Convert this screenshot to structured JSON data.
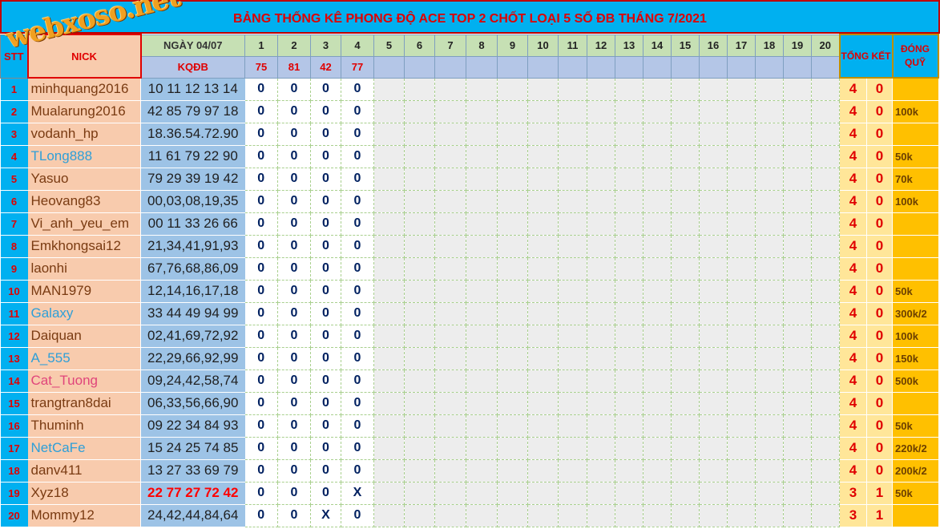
{
  "title": "BẢNG THỐNG KÊ PHONG ĐỘ ACE TOP 2 CHỐT LOẠI 5 SỐ ĐB THÁNG 7/2021",
  "watermark": "webxoso.net",
  "header": {
    "stt": "STT",
    "nick": "NICK",
    "date": "NGÀY 04/07",
    "kqdb": "KQĐB",
    "tong_ket": "TỔNG KẾT",
    "dong_quy": "ĐÓNG QUỸ",
    "days": [
      "1",
      "2",
      "3",
      "4",
      "5",
      "6",
      "7",
      "8",
      "9",
      "10",
      "11",
      "12",
      "13",
      "14",
      "15",
      "16",
      "17",
      "18",
      "19",
      "20"
    ],
    "results": [
      "75",
      "81",
      "42",
      "77",
      "",
      "",
      "",
      "",
      "",
      "",
      "",
      "",
      "",
      "",
      "",
      "",
      "",
      "",
      "",
      ""
    ]
  },
  "colors": {
    "title_bg": "#00b0f0",
    "title_text": "#e00000",
    "nick_bg": "#f8cbad",
    "nums_bg": "#9dc3e6",
    "tong_bg": "#ffe699",
    "quy_bg": "#ffc000",
    "blue_nick": "#2e9fd8",
    "pink_nick": "#e0457b"
  },
  "rows": [
    {
      "stt": "1",
      "nick": "minhquang2016",
      "color": "#7a3b12",
      "nums": "10 11 12 13 14",
      "hl": false,
      "d": [
        "0",
        "0",
        "0",
        "0"
      ],
      "w": "4",
      "l": "0",
      "q": ""
    },
    {
      "stt": "2",
      "nick": "Mualarung2016",
      "color": "#7a3b12",
      "nums": "42 85 79 97 18",
      "hl": false,
      "d": [
        "0",
        "0",
        "0",
        "0"
      ],
      "w": "4",
      "l": "0",
      "q": "100k"
    },
    {
      "stt": "3",
      "nick": "vodanh_hp",
      "color": "#7a3b12",
      "nums": "18.36.54.72.90",
      "hl": false,
      "d": [
        "0",
        "0",
        "0",
        "0"
      ],
      "w": "4",
      "l": "0",
      "q": ""
    },
    {
      "stt": "4",
      "nick": "TLong888",
      "color": "#2e9fd8",
      "nums": "11 61 79 22 90",
      "hl": false,
      "d": [
        "0",
        "0",
        "0",
        "0"
      ],
      "w": "4",
      "l": "0",
      "q": "50k"
    },
    {
      "stt": "5",
      "nick": "Yasuo",
      "color": "#7a3b12",
      "nums": "79 29 39 19 42",
      "hl": false,
      "d": [
        "0",
        "0",
        "0",
        "0"
      ],
      "w": "4",
      "l": "0",
      "q": "70k"
    },
    {
      "stt": "6",
      "nick": "Heovang83",
      "color": "#7a3b12",
      "nums": "00,03,08,19,35",
      "hl": false,
      "d": [
        "0",
        "0",
        "0",
        "0"
      ],
      "w": "4",
      "l": "0",
      "q": "100k"
    },
    {
      "stt": "7",
      "nick": "Vi_anh_yeu_em",
      "color": "#7a3b12",
      "nums": "00 11 33 26 66",
      "hl": false,
      "d": [
        "0",
        "0",
        "0",
        "0"
      ],
      "w": "4",
      "l": "0",
      "q": ""
    },
    {
      "stt": "8",
      "nick": "Emkhongsai12",
      "color": "#7a3b12",
      "nums": "21,34,41,91,93",
      "hl": false,
      "d": [
        "0",
        "0",
        "0",
        "0"
      ],
      "w": "4",
      "l": "0",
      "q": ""
    },
    {
      "stt": "9",
      "nick": "laonhi",
      "color": "#7a3b12",
      "nums": "67,76,68,86,09",
      "hl": false,
      "d": [
        "0",
        "0",
        "0",
        "0"
      ],
      "w": "4",
      "l": "0",
      "q": ""
    },
    {
      "stt": "10",
      "nick": "MAN1979",
      "color": "#7a3b12",
      "nums": "12,14,16,17,18",
      "hl": false,
      "d": [
        "0",
        "0",
        "0",
        "0"
      ],
      "w": "4",
      "l": "0",
      "q": "50k"
    },
    {
      "stt": "11",
      "nick": "Galaxy",
      "color": "#2e9fd8",
      "nums": "33 44 49 94 99",
      "hl": false,
      "d": [
        "0",
        "0",
        "0",
        "0"
      ],
      "w": "4",
      "l": "0",
      "q": "300k/2"
    },
    {
      "stt": "12",
      "nick": "Daiquan",
      "color": "#7a3b12",
      "nums": "02,41,69,72,92",
      "hl": false,
      "d": [
        "0",
        "0",
        "0",
        "0"
      ],
      "w": "4",
      "l": "0",
      "q": "100k"
    },
    {
      "stt": "13",
      "nick": "A_555",
      "color": "#2e9fd8",
      "nums": "22,29,66,92,99",
      "hl": false,
      "d": [
        "0",
        "0",
        "0",
        "0"
      ],
      "w": "4",
      "l": "0",
      "q": "150k"
    },
    {
      "stt": "14",
      "nick": "Cat_Tuong",
      "color": "#e0457b",
      "nums": "09,24,42,58,74",
      "hl": false,
      "d": [
        "0",
        "0",
        "0",
        "0"
      ],
      "w": "4",
      "l": "0",
      "q": "500k"
    },
    {
      "stt": "15",
      "nick": "trangtran8dai",
      "color": "#7a3b12",
      "nums": "06,33,56,66,90",
      "hl": false,
      "d": [
        "0",
        "0",
        "0",
        "0"
      ],
      "w": "4",
      "l": "0",
      "q": ""
    },
    {
      "stt": "16",
      "nick": "Thuminh",
      "color": "#7a3b12",
      "nums": "09 22 34 84 93",
      "hl": false,
      "d": [
        "0",
        "0",
        "0",
        "0"
      ],
      "w": "4",
      "l": "0",
      "q": "50k"
    },
    {
      "stt": "17",
      "nick": "NetCaFe",
      "color": "#2e9fd8",
      "nums": "15 24 25 74 85",
      "hl": false,
      "d": [
        "0",
        "0",
        "0",
        "0"
      ],
      "w": "4",
      "l": "0",
      "q": "220k/2"
    },
    {
      "stt": "18",
      "nick": "danv411",
      "color": "#7a3b12",
      "nums": "13 27 33 69 79",
      "hl": false,
      "d": [
        "0",
        "0",
        "0",
        "0"
      ],
      "w": "4",
      "l": "0",
      "q": "200k/2"
    },
    {
      "stt": "19",
      "nick": "Xyz18",
      "color": "#7a3b12",
      "nums": "22 77 27 72 42",
      "hl": true,
      "d": [
        "0",
        "0",
        "0",
        "X"
      ],
      "w": "3",
      "l": "1",
      "q": "50k"
    },
    {
      "stt": "20",
      "nick": "Mommy12",
      "color": "#7a3b12",
      "nums": "24,42,44,84,64",
      "hl": false,
      "d": [
        "0",
        "0",
        "X",
        "0"
      ],
      "w": "3",
      "l": "1",
      "q": ""
    }
  ]
}
